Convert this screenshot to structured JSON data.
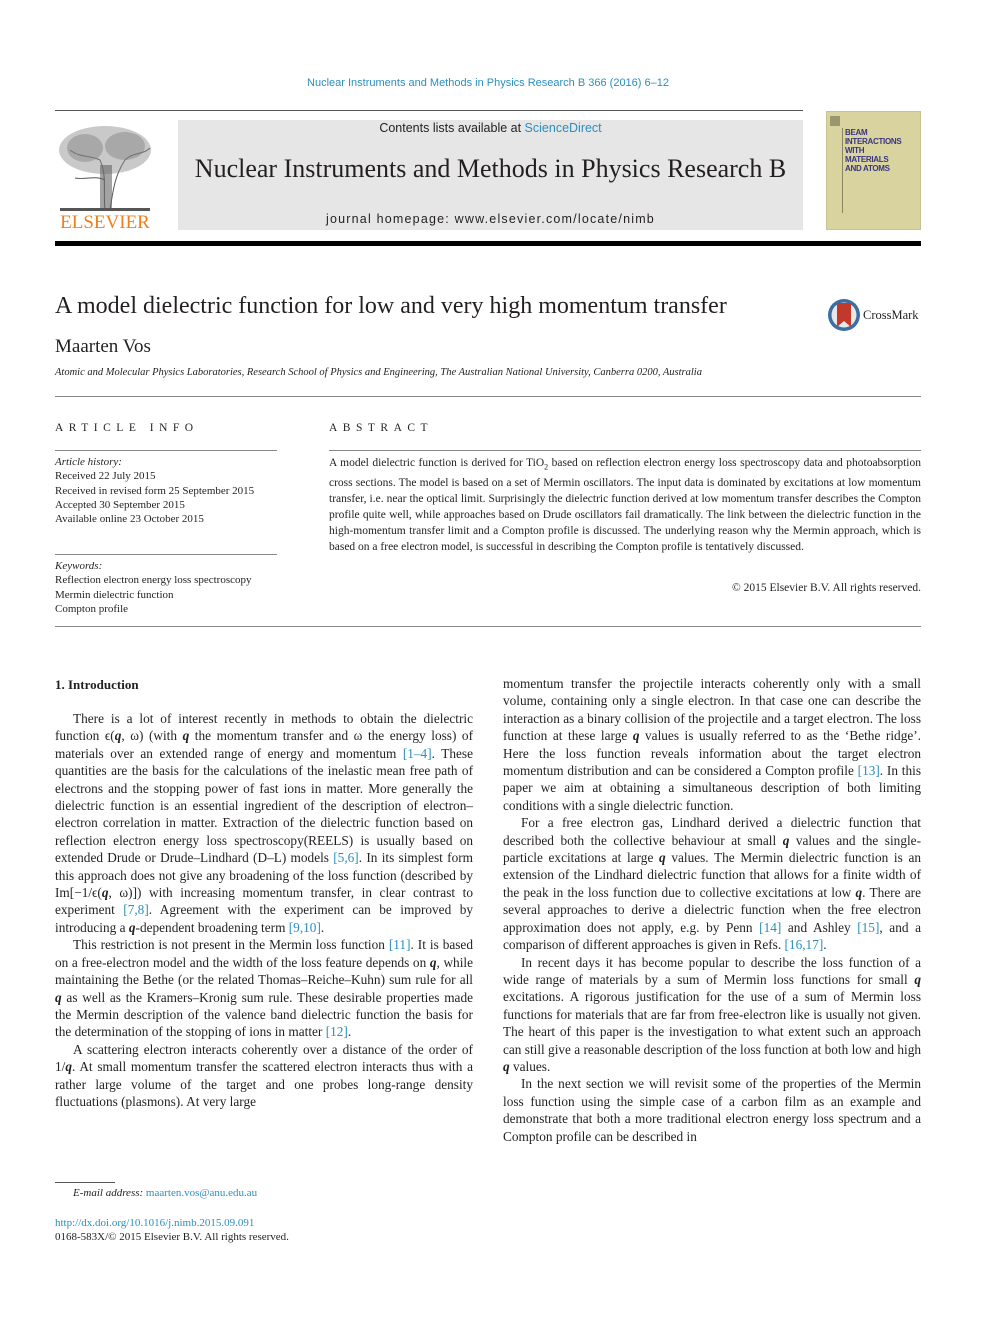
{
  "header": {
    "journal_ref": "Nuclear Instruments and Methods in Physics Research B 366 (2016) 6–12",
    "contents_prefix": "Contents lists available at ",
    "contents_link": "ScienceDirect",
    "journal_title": "Nuclear Instruments and Methods in Physics Research B",
    "homepage": "journal homepage: www.elsevier.com/locate/nimb",
    "publisher_logo": "ELSEVIER",
    "cover_text": [
      "BEAM",
      "INTERACTIONS",
      "WITH",
      "MATERIALS",
      "AND ATOMS"
    ],
    "colors": {
      "link": "#2a8fbd",
      "elsevier_orange": "#f07f1a",
      "banner_bg": "#e6e6e6",
      "cover_bg": "#d8d39f",
      "cover_text": "#3a3580"
    }
  },
  "article": {
    "title": "A model dielectric function for low and very high momentum transfer",
    "crossmark_label": "CrossMark",
    "author": "Maarten Vos",
    "affiliation": "Atomic and Molecular Physics Laboratories, Research School of Physics and Engineering, The Australian National University, Canberra 0200, Australia"
  },
  "article_info": {
    "heading": "ARTICLE INFO",
    "history_label": "Article history:",
    "history": [
      "Received 22 July 2015",
      "Received in revised form 25 September 2015",
      "Accepted 30 September 2015",
      "Available online 23 October 2015"
    ],
    "keywords_label": "Keywords:",
    "keywords": [
      "Reflection electron energy loss spectroscopy",
      "Mermin dielectric function",
      "Compton profile"
    ]
  },
  "abstract": {
    "heading": "ABSTRACT",
    "text_before_formula": "A model dielectric function is derived for TiO",
    "formula_sub": "2",
    "text_after_formula": " based on reflection electron energy loss spectroscopy data and photoabsorption cross sections. The model is based on a set of Mermin oscillators. The input data is dominated by excitations at low momentum transfer, i.e. near the optical limit. Surprisingly the dielectric function derived at low momentum transfer describes the Compton profile quite well, while approaches based on Drude oscillators fail dramatically. The link between the dielectric function in the high-momentum transfer limit and a Compton profile is discussed. The underlying reason why the Mermin approach, which is based on a free electron model, is successful in describing the Compton profile is tentatively discussed.",
    "copyright": "© 2015 Elsevier B.V. All rights reserved."
  },
  "body": {
    "section_title": "1. Introduction",
    "left": {
      "p1": [
        "There is a lot of interest recently in methods to obtain the dielectric function ϵ(",
        "q",
        ", ω) (with ",
        "q",
        " the momentum transfer and ω the energy loss) of materials over an extended range of energy and momentum ",
        "[1–4]",
        ". These quantities are the basis for the calculations of the inelastic mean free path of electrons and the stopping power of fast ions in matter. More generally the dielectric function is an essential ingredient of the description of electron–electron correlation in matter. Extraction of the dielectric function based on reflection electron energy loss spectroscopy(REELS) is usually based on extended Drude or Drude–Lindhard (D–L) models ",
        "[5,6]",
        ". In its simplest form this approach does not give any broadening of the loss function (described by Im[−1/ϵ(",
        "q",
        ", ω)]) with increasing momentum transfer, in clear contrast to experiment ",
        "[7,8]",
        ". Agreement with the experiment can be improved by introducing a ",
        "q",
        "-dependent broadening term ",
        "[9,10]",
        "."
      ],
      "p2": [
        "This restriction is not present in the Mermin loss function ",
        "[11]",
        ". It is based on a free-electron model and the width of the loss feature depends on ",
        "q",
        ", while maintaining the Bethe (or the related Thomas–Reiche–Kuhn) sum rule for all ",
        "q",
        " as well as the Kramers–Kronig sum rule. These desirable properties made the Mermin description of the valence band dielectric function the basis for the determination of the stopping of ions in matter ",
        "[12]",
        "."
      ],
      "p3": [
        "A scattering electron interacts coherently over a distance of the order of 1/",
        "q",
        ". At small momentum transfer the scattered electron interacts thus with a rather large volume of the target and one probes long-range density fluctuations (plasmons). At very large"
      ]
    },
    "right": {
      "p1": [
        "momentum transfer the projectile interacts coherently only with a small volume, containing only a single electron. In that case one can describe the interaction as a binary collision of the projectile and a target electron. The loss function at these large ",
        "q",
        " values is usually referred to as the ‘Bethe ridge’. Here the loss function reveals information about the target electron momentum distribution and can be considered a Compton profile ",
        "[13]",
        ". In this paper we aim at obtaining a simultaneous description of both limiting conditions with a single dielectric function."
      ],
      "p2": [
        "For a free electron gas, Lindhard derived a dielectric function that described both the collective behaviour at small ",
        "q",
        " values and the single-particle excitations at large ",
        "q",
        " values. The Mermin dielectric function is an extension of the Lindhard dielectric function that allows for a finite width of the peak in the loss function due to collective excitations at low ",
        "q",
        ". There are several approaches to derive a dielectric function when the free electron approximation does not apply, e.g. by Penn ",
        "[14]",
        " and Ashley ",
        "[15]",
        ", and a comparison of different approaches is given in Refs. ",
        "[16,17]",
        "."
      ],
      "p3": [
        "In recent days it has become popular to describe the loss function of a wide range of materials by a sum of Mermin loss functions for small ",
        "q",
        " excitations. A rigorous justification for the use of a sum of Mermin loss functions for materials that are far from free-electron like is usually not given. The heart of this paper is the investigation to what extent such an approach can still give a reasonable description of the loss function at both low and high ",
        "q",
        " values."
      ],
      "p4": [
        "In the next section we will revisit some of the properties of the Mermin loss function using the simple case of a carbon film as an example and demonstrate that both a more traditional electron energy loss spectrum and a Compton profile can be described in"
      ]
    }
  },
  "footer": {
    "email_label": "E-mail address: ",
    "email": "maarten.vos@anu.edu.au",
    "doi": "http://dx.doi.org/10.1016/j.nimb.2015.09.091",
    "issn": "0168-583X/© 2015 Elsevier B.V. All rights reserved."
  }
}
